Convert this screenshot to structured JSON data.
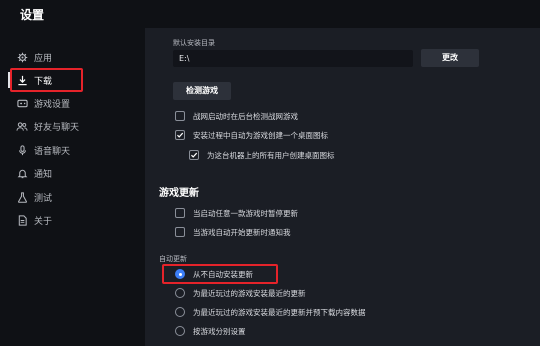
{
  "window": {
    "title": "设置"
  },
  "sidebar": {
    "items": [
      {
        "label": "应用",
        "icon": "gear-icon"
      },
      {
        "label": "下载",
        "icon": "download-icon",
        "active": true
      },
      {
        "label": "游戏设置",
        "icon": "gamepad-icon"
      },
      {
        "label": "好友与聊天",
        "icon": "people-icon"
      },
      {
        "label": "语音聊天",
        "icon": "microphone-icon"
      },
      {
        "label": "通知",
        "icon": "bell-icon"
      },
      {
        "label": "测试",
        "icon": "flask-icon"
      },
      {
        "label": "关于",
        "icon": "document-icon"
      }
    ]
  },
  "download": {
    "default_dir_label": "默认安装目录",
    "default_dir_value": "E:\\",
    "change_button": "更改",
    "detect_button": "检测游戏",
    "options": [
      {
        "label": "战网启动时在后台检测战网游戏",
        "checked": false
      },
      {
        "label": "安装过程中自动为游戏创建一个桌面图标",
        "checked": true
      },
      {
        "label": "为这台机器上的所有用户创建桌面图标",
        "checked": true
      }
    ]
  },
  "updates": {
    "title": "游戏更新",
    "options": [
      {
        "label": "当启动任意一款游戏时暂停更新",
        "checked": false
      },
      {
        "label": "当游戏自动开始更新时通知我",
        "checked": false
      }
    ],
    "auto_update_label": "自动更新",
    "radios": [
      {
        "label": "从不自动安装更新",
        "selected": true
      },
      {
        "label": "为最近玩过的游戏安装最近的更新",
        "selected": false
      },
      {
        "label": "为最近玩过的游戏安装最近的更新并预下载内容数据",
        "selected": false
      },
      {
        "label": "按游戏分别设置",
        "selected": false
      }
    ]
  },
  "colors": {
    "accent": "#3d7ef5",
    "highlight": "#e5232a",
    "background": "#1b1e25",
    "sidebar": "#0f1115"
  }
}
